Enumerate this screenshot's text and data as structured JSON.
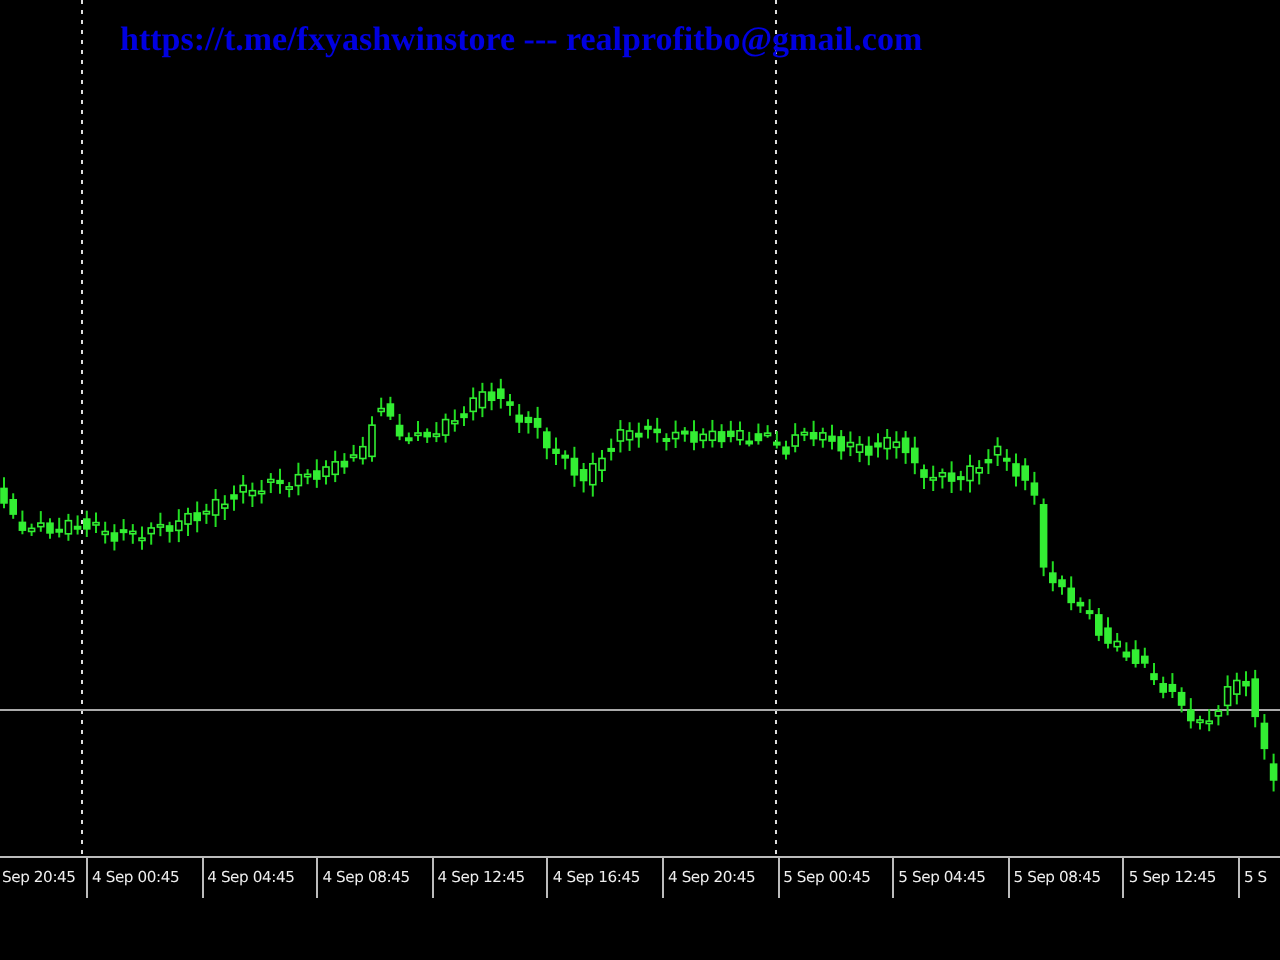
{
  "chart_label": {
    "text": "https://t.me/fxyashwinstore --- realprofitbo@gmail.com"
  },
  "time_axis": {
    "labels": [
      "Sep 20:45",
      "4 Sep 00:45",
      "4 Sep 04:45",
      "4 Sep 08:45",
      "4 Sep 12:45",
      "4 Sep 16:45",
      "4 Sep 20:45",
      "5 Sep 00:45",
      "5 Sep 04:45",
      "5 Sep 08:45",
      "5 Sep 12:45",
      "5 S"
    ]
  }
}
